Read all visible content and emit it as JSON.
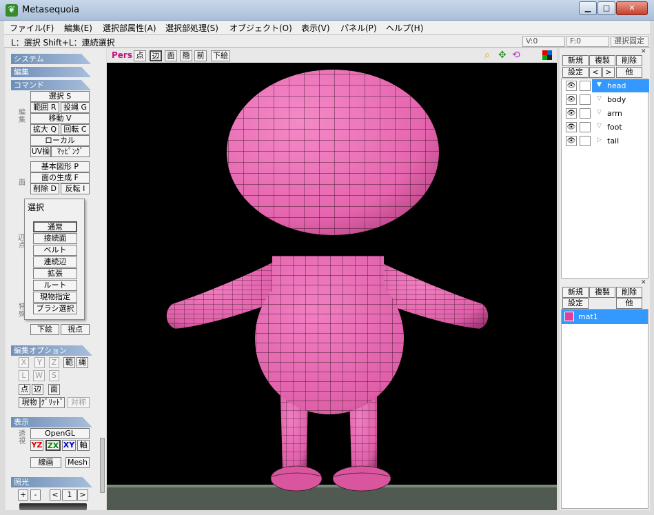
{
  "window": {
    "title": "Metasequoia",
    "minimize": "▁",
    "maximize": "□",
    "close": "✕"
  },
  "menu": [
    "ファイル(F)",
    "編集(E)",
    "選択部属性(A)",
    "選択部処理(S)",
    "オブジェクト(O)",
    "表示(V)",
    "パネル(P)",
    "ヘルプ(H)"
  ],
  "status": {
    "text": "L：選択  Shift+L：連続選択",
    "v": "V:0",
    "f": "F:0",
    "lock": "選択固定"
  },
  "left": {
    "system": "システム",
    "edit": "編集",
    "command": "コマンド",
    "cmd": {
      "select": "選択 S",
      "range": "範囲 R",
      "lasso": "投縄 G",
      "move": "移動 V",
      "scale": "拡大 Q",
      "rotate": "回転 C",
      "local": "ローカル",
      "uv": "UV操",
      "mapping": "ﾏｯﾋﾟﾝｸﾞ",
      "basic": "基本図形 P",
      "face_gen": "面の生成 F",
      "delete": "削除 D",
      "flip": "反転 I",
      "shita": "下絵",
      "view": "視点"
    },
    "vlabels": {
      "edit_v": "編集",
      "face_v": "面",
      "edge_v": "辺・点",
      "special_v": "特殊"
    },
    "popup": {
      "title": "選択",
      "items": [
        "通常",
        "接続面",
        "ベルト",
        "連続辺",
        "拡張",
        "ルート",
        "現物指定",
        "ブラシ選択"
      ]
    },
    "opt": {
      "header": "編集オプション",
      "x": "X",
      "y": "Y",
      "z": "Z",
      "range": "範",
      "lasso": "縄",
      "l": "L",
      "w": "W",
      "s": "S",
      "point": "点",
      "edge": "辺",
      "face": "面",
      "current": "現物",
      "grid": "ｸﾞﾘｯﾄﾞ",
      "sym": "対称"
    },
    "disp": {
      "header": "表示",
      "opengl": "OpenGL",
      "yz": "YZ",
      "zx": "ZX",
      "xy": "XY",
      "axis": "軸",
      "wire": "線画",
      "mesh": "Mesh",
      "trans": "透視"
    },
    "light": {
      "header": "照光",
      "plus": "+",
      "minus": "-",
      "lt": "<",
      "num": "1",
      "gt": ">"
    }
  },
  "view": {
    "pers": "Pers",
    "point": "点",
    "edge": "辺",
    "face": "面",
    "simple": "簡",
    "front": "前",
    "under": "下絵"
  },
  "right": {
    "obj": {
      "new": "新規",
      "dup": "複製",
      "del": "削除",
      "set": "設定",
      "lt": "<",
      "gt": ">",
      "other": "他"
    },
    "objects": [
      "head",
      "body",
      "arm",
      "foot",
      "tail"
    ],
    "mat": {
      "new": "新規",
      "dup": "複製",
      "del": "削除",
      "set": "設定",
      "other": "他"
    },
    "materials": [
      "mat1"
    ]
  },
  "colors": {
    "accent": "#3399ff",
    "mesh": "#e665ae",
    "material": "#e0409a"
  }
}
